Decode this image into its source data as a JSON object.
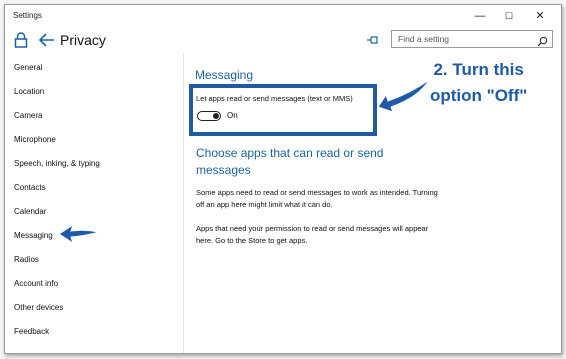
{
  "window": {
    "title": "Settings",
    "controls": {
      "minimize": "—",
      "maximize": "☐",
      "close": "✕"
    }
  },
  "header": {
    "title": "Privacy",
    "search_placeholder": "Find a setting"
  },
  "sidebar": {
    "items": [
      {
        "label": "General"
      },
      {
        "label": "Location"
      },
      {
        "label": "Camera"
      },
      {
        "label": "Microphone"
      },
      {
        "label": "Speech, inking, & typing"
      },
      {
        "label": "Contacts"
      },
      {
        "label": "Calendar"
      },
      {
        "label": "Messaging",
        "selected": true
      },
      {
        "label": "Radios"
      },
      {
        "label": "Account info"
      },
      {
        "label": "Other devices"
      },
      {
        "label": "Feedback"
      }
    ]
  },
  "main": {
    "section_title": "Messaging",
    "toggle_label": "Let apps read or send messages (text or MMS)",
    "toggle_state": "On",
    "toggle_on": true,
    "heading": "Choose apps that can read or send messages",
    "paragraph1": "Some apps need to read or send messages to work as intended. Turning off an app here might limit what it can do.",
    "paragraph2": "Apps that need your permission to read or send messages will appear here. Go to the Store to get apps."
  },
  "annotation": {
    "text": "2. Turn this\noption \"Off\"",
    "color": "#1f5aa6"
  },
  "colors": {
    "accent": "#1a63a3",
    "annotation_blue": "#1f5aa6"
  },
  "icons": {
    "lock": "lock-icon",
    "back": "back-arrow-icon",
    "pin": "pin-icon",
    "search": "search-icon"
  }
}
